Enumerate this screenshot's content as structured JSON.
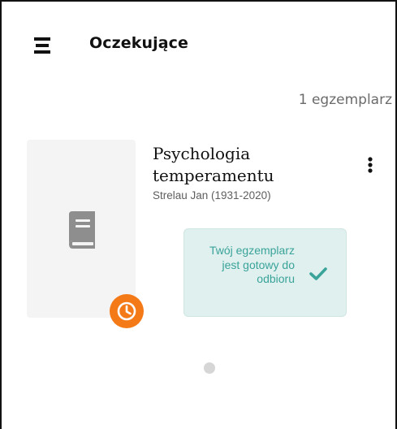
{
  "header": {
    "title": "Oczekujące",
    "menu_icon": "hamburger-menu-icon"
  },
  "summary": {
    "count_label": "1 egzemplarz"
  },
  "item": {
    "title": "Psychologia temperamentu",
    "author": "Strelau Jan (1931-2020)",
    "cover_icon": "book-icon",
    "badge_icon": "clock-icon",
    "more_icon": "more-vertical-icon",
    "status": {
      "text": "Twój egzemplarz jest gotowy do odbioru",
      "icon": "check-icon"
    }
  },
  "pagination": {
    "current_page": 1,
    "total_pages": 1
  },
  "colors": {
    "accent_orange": "#f47a18",
    "status_background": "#dff0ee",
    "status_text": "#3aa39a",
    "cover_placeholder": "#f4f4f4",
    "book_icon": "#8e8e8e"
  }
}
